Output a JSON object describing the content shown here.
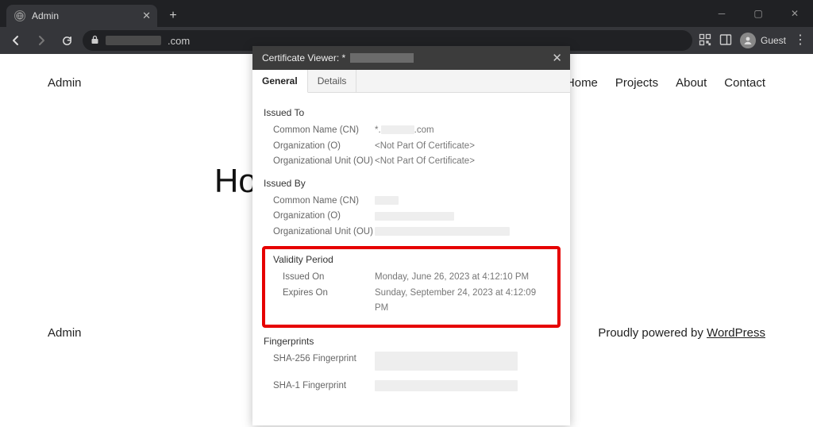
{
  "browser": {
    "tab_title": "Admin",
    "url_suffix": ".com",
    "guest_label": "Guest"
  },
  "site": {
    "brand": "Admin",
    "nav": {
      "home": "Home",
      "projects": "Projects",
      "about": "About",
      "contact": "Contact"
    },
    "hero_prefix": "Ho",
    "footer_brand": "Admin",
    "powered_text": "Proudly powered by ",
    "powered_link": "WordPress"
  },
  "cert": {
    "title_prefix": "Certificate Viewer: *",
    "tabs": {
      "general": "General",
      "details": "Details"
    },
    "issued_to": {
      "title": "Issued To",
      "cn_label": "Common Name (CN)",
      "cn_value_prefix": "*.",
      "cn_value_suffix": ".com",
      "o_label": "Organization (O)",
      "o_value": "<Not Part Of Certificate>",
      "ou_label": "Organizational Unit (OU)",
      "ou_value": "<Not Part Of Certificate>"
    },
    "issued_by": {
      "title": "Issued By",
      "cn_label": "Common Name (CN)",
      "o_label": "Organization (O)",
      "ou_label": "Organizational Unit (OU)"
    },
    "validity": {
      "title": "Validity Period",
      "issued_label": "Issued On",
      "issued_value": "Monday, June 26, 2023 at 4:12:10 PM",
      "expires_label": "Expires On",
      "expires_value": "Sunday, September 24, 2023 at 4:12:09 PM"
    },
    "fingerprints": {
      "title": "Fingerprints",
      "sha256_label": "SHA-256 Fingerprint",
      "sha1_label": "SHA-1 Fingerprint"
    }
  }
}
